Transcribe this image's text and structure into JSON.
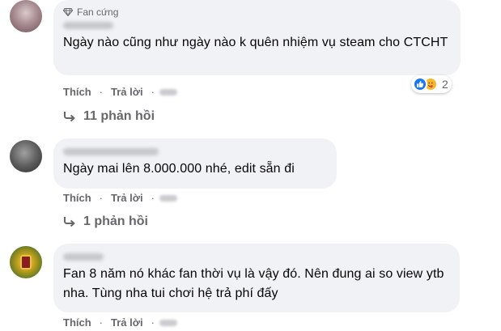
{
  "comments": [
    {
      "badge": "Fan cứng",
      "text": "Ngày nào cũng như ngày nào k quên nhiệm vụ steam cho CTCHT",
      "actions": {
        "like": "Thích",
        "reply": "Trả lời"
      },
      "reactions": {
        "icons": [
          "like-icon",
          "care-icon"
        ],
        "count": "2"
      },
      "replies": "11 phản hồi"
    },
    {
      "text": "Ngày mai lên 8.000.000 nhé, edit sẵn đi",
      "actions": {
        "like": "Thích",
        "reply": "Trả lời"
      },
      "replies": "1 phản hồi"
    },
    {
      "text": "Fan 8 năm nó khác fan thời vụ là vậy đó. Nên đung ai so view ytb nha. Tùng nha tui chơi hệ trả phí đấy",
      "actions": {
        "like": "Thích",
        "reply": "Trả lời"
      }
    }
  ],
  "separator": "·",
  "colors": {
    "bubble": "#f0f2f5",
    "secondary_text": "#65676b",
    "like_blue": "#1877f2",
    "care_yellow": "#f7b928"
  }
}
